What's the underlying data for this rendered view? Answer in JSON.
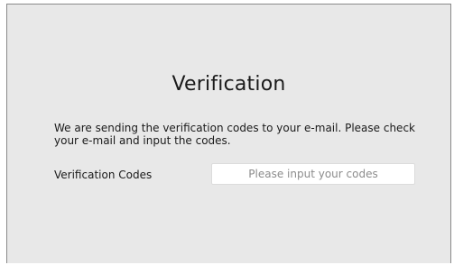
{
  "page": {
    "title": "Verification",
    "message": "We are sending the verification codes to your e-mail. Please check your e-mail and input the codes."
  },
  "form": {
    "codes_label": "Verification Codes",
    "codes_value": "",
    "codes_placeholder": "Please input your codes"
  },
  "colors": {
    "panel_background": "#e8e8e8",
    "panel_border": "#8a8a8a",
    "input_background": "#ffffff"
  }
}
